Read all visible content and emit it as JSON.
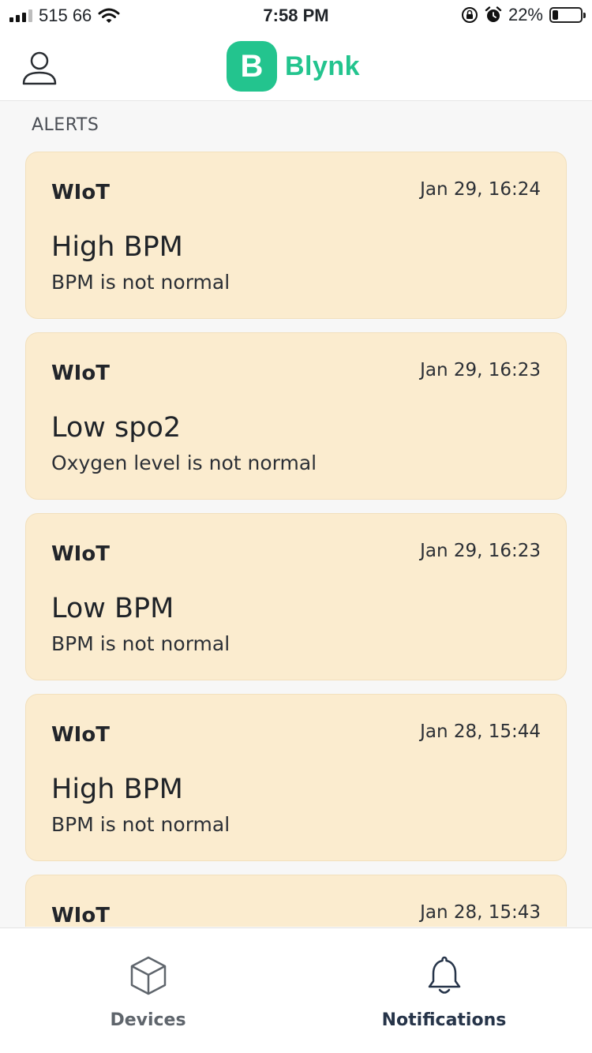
{
  "status_bar": {
    "carrier": "515 66",
    "time": "7:58 PM",
    "battery_percent_label": "22%",
    "battery_level": 0.22,
    "icons": [
      "signal-icon",
      "wifi-icon",
      "rotation-lock-icon",
      "alarm-icon",
      "battery-icon"
    ]
  },
  "header": {
    "logo_letter": "B",
    "app_name": "Blynk",
    "brand_color": "#23c48e",
    "profile_icon": "user-icon"
  },
  "section_title": "ALERTS",
  "alerts": [
    {
      "source": "WIoT",
      "time": "Jan 29, 16:24",
      "title": "High BPM",
      "message": "BPM is not normal"
    },
    {
      "source": "WIoT",
      "time": "Jan 29, 16:23",
      "title": "Low spo2",
      "message": "Oxygen level is not normal"
    },
    {
      "source": "WIoT",
      "time": "Jan 29, 16:23",
      "title": "Low BPM",
      "message": "BPM is not normal"
    },
    {
      "source": "WIoT",
      "time": "Jan 28, 15:44",
      "title": "High BPM",
      "message": "BPM is not normal"
    },
    {
      "source": "WIoT",
      "time": "Jan 28, 15:43",
      "title": "",
      "message": ""
    }
  ],
  "card_color": "#fbeccf",
  "tabs": [
    {
      "label": "Devices",
      "icon": "cube-icon",
      "active": false
    },
    {
      "label": "Notifications",
      "icon": "bell-icon",
      "active": true
    }
  ]
}
